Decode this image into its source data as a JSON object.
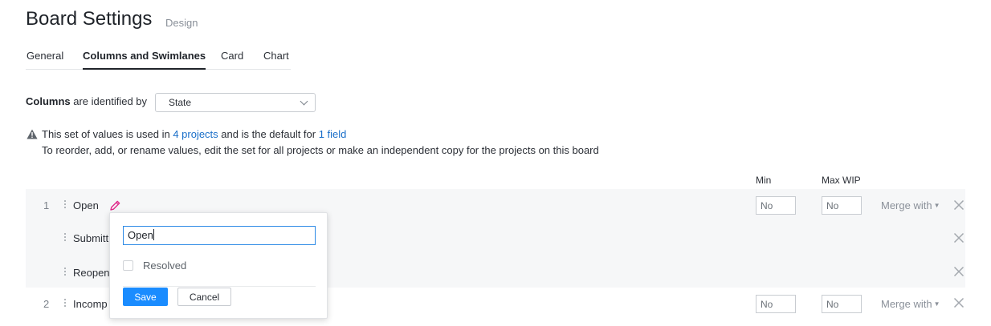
{
  "header": {
    "title": "Board Settings",
    "subtitle": "Design"
  },
  "tabs": [
    {
      "label": "General",
      "active": false
    },
    {
      "label": "Columns and Swimlanes",
      "active": true
    },
    {
      "label": "Card",
      "active": false
    },
    {
      "label": "Chart",
      "active": false
    }
  ],
  "columns_config": {
    "label_bold": "Columns",
    "label_rest": " are identified by",
    "select_value": "State"
  },
  "warning": {
    "icon": "warning-icon",
    "text_1": "This set of values is used in ",
    "link_projects": "4 projects",
    "text_2": " and is the default for ",
    "link_field": "1 field",
    "info": "To reorder, add, or rename values, edit the set for all projects or make an independent copy for the projects on this board"
  },
  "table_headers": {
    "min": "Min",
    "max_wip": "Max WIP"
  },
  "rows": [
    {
      "number": "1",
      "label": "Open",
      "min": "No",
      "max": "No",
      "merge": "Merge with"
    },
    {
      "number": "",
      "label": "Submitt",
      "min": "",
      "max": "",
      "merge": ""
    },
    {
      "number": "",
      "label": "Reopen",
      "min": "",
      "max": "",
      "merge": ""
    },
    {
      "number": "2",
      "label": "Incomp",
      "min": "No",
      "max": "No",
      "merge": "Merge with"
    }
  ],
  "popup": {
    "input_value": "Open",
    "checkbox_label": "Resolved",
    "checkbox_checked": false,
    "save_label": "Save",
    "cancel_label": "Cancel"
  },
  "colors": {
    "accent": "#1a8cff",
    "link": "#1a6fc9",
    "pencil": "#e0298a",
    "group_background": "#f6f7f8"
  }
}
